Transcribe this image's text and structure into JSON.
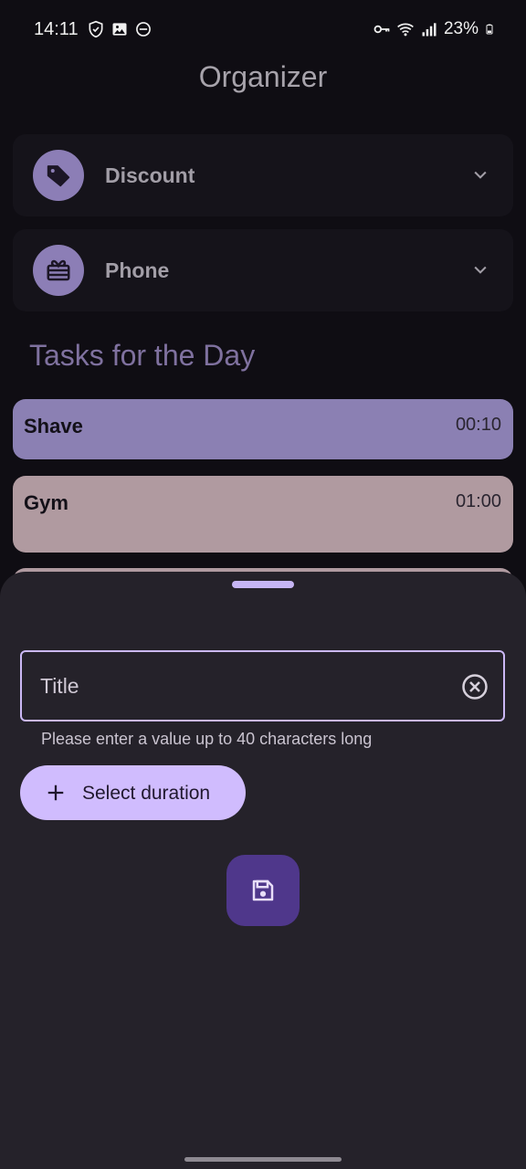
{
  "status_bar": {
    "time": "14:11",
    "battery": "23%",
    "left_icons": [
      "shield-icon",
      "image-icon",
      "dnd-icon"
    ],
    "right_icons": [
      "vpn-key-icon",
      "wifi-icon",
      "signal-icon",
      "battery-icon"
    ]
  },
  "app": {
    "title": "Organizer"
  },
  "categories": [
    {
      "label": "Discount",
      "icon": "tag-icon"
    },
    {
      "label": "Phone",
      "icon": "gift-card-icon"
    }
  ],
  "section_title": "Tasks for the Day",
  "tasks": [
    {
      "title": "Shave",
      "time": "00:10",
      "color": "#8b80b3"
    },
    {
      "title": "Gym",
      "time": "01:00",
      "color": "#b09aa0"
    }
  ],
  "sheet": {
    "title_placeholder": "Title",
    "title_value": "",
    "helper_text": "Please enter a value up to 40 characters long",
    "duration_button_label": "Select duration",
    "save_icon": "save-icon"
  },
  "colors": {
    "background": "#0f0d13",
    "sheet": "#25222a",
    "accent": "#d0bcfe",
    "fab": "#4f378b"
  }
}
